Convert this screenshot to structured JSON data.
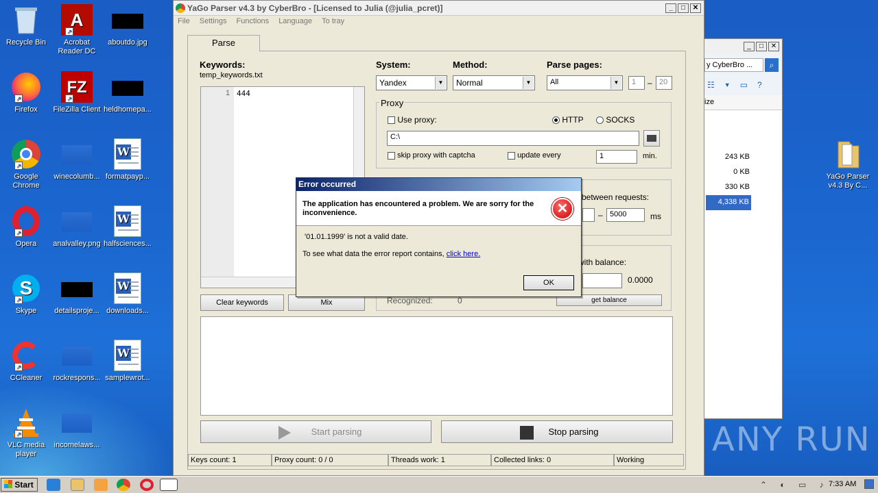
{
  "desktop": {
    "icons": [
      {
        "label": "Recycle Bin",
        "icon": "recycle-bin-icon"
      },
      {
        "label": "Acrobat Reader DC",
        "icon": "acrobat-icon"
      },
      {
        "label": "aboutdo.jpg",
        "icon": "image-file-icon"
      },
      {
        "label": "Firefox",
        "icon": "firefox-icon"
      },
      {
        "label": "FileZilla Client",
        "icon": "filezilla-icon"
      },
      {
        "label": "heldhomepa...",
        "icon": "image-file-icon"
      },
      {
        "label": "Google Chrome",
        "icon": "chrome-icon"
      },
      {
        "label": "winecolumb...",
        "icon": "image-file-icon"
      },
      {
        "label": "formatpayp...",
        "icon": "word-doc-icon"
      },
      {
        "label": "Opera",
        "icon": "opera-icon"
      },
      {
        "label": "analvalley.png",
        "icon": "image-file-icon"
      },
      {
        "label": "halfsciences...",
        "icon": "word-doc-icon"
      },
      {
        "label": "Skype",
        "icon": "skype-icon"
      },
      {
        "label": "detailsproje...",
        "icon": "image-file-icon"
      },
      {
        "label": "downloads...",
        "icon": "word-doc-icon"
      },
      {
        "label": "CCleaner",
        "icon": "ccleaner-icon"
      },
      {
        "label": "rockrespons...",
        "icon": "image-file-icon"
      },
      {
        "label": "samplewrot...",
        "icon": "word-doc-icon"
      },
      {
        "label": "VLC media player",
        "icon": "vlc-icon"
      },
      {
        "label": "incomelaws...",
        "icon": "image-file-icon"
      },
      {
        "label": "YaGo Parser v4.3 By C...",
        "icon": "folder-icon"
      }
    ]
  },
  "bgwin": {
    "address": "y CyberBro ...",
    "col": "ize",
    "sizes": [
      "243 KB",
      "0 KB",
      "330 KB",
      "4,338 KB"
    ]
  },
  "app": {
    "title": "YaGo Parser v4.3 by CyberBro - [Licensed to Julia (@julia_pcret)]",
    "menu": [
      "File",
      "Settings",
      "Functions",
      "Language",
      "To tray"
    ],
    "tab": "Parse",
    "keywords_label": "Keywords:",
    "keywords_file": "temp_keywords.txt",
    "editor_line": "1",
    "editor_text": "444",
    "system_label": "System:",
    "system_value": "Yandex",
    "method_label": "Method:",
    "method_value": "Normal",
    "pages_label": "Parse pages:",
    "pages_value": "All",
    "page_from": "1",
    "page_dash": "–",
    "page_to": "20",
    "proxy_title": "Proxy",
    "use_proxy": "Use proxy:",
    "http": "HTTP",
    "socks": "SOCKS",
    "proxy_path": "C:\\",
    "skip_captcha": "skip proxy with captcha",
    "update_every": "update every",
    "update_value": "1",
    "min": "min.",
    "threads_title": "Th...",
    "between": "between requests:",
    "delay_dash": "–",
    "delay_to": "5000",
    "ms": "ms",
    "balance_label": "with balance:",
    "balance_value": "0.0000",
    "get_balance": "get balance",
    "recognized": "Recognized:",
    "recognized_value": "0",
    "clear_keywords": "Clear keywords",
    "mix": "Mix",
    "start": "Start parsing",
    "stop": "Stop parsing",
    "status": [
      "Keys count: 1",
      "Proxy count: 0 / 0",
      "Threads work: 1",
      "Collected links: 0",
      "Working"
    ]
  },
  "dialog": {
    "title": "Error occurred",
    "heading": "The application has encountered a problem. We are sorry for the inconvenience.",
    "message": "'01.01.1999' is not a valid date.",
    "report_text": "To see what data the error report contains,",
    "report_link": "click here.",
    "ok": "OK"
  },
  "taskbar": {
    "start": "Start",
    "time": "7:33 AM"
  },
  "watermark": "ANY RUN"
}
